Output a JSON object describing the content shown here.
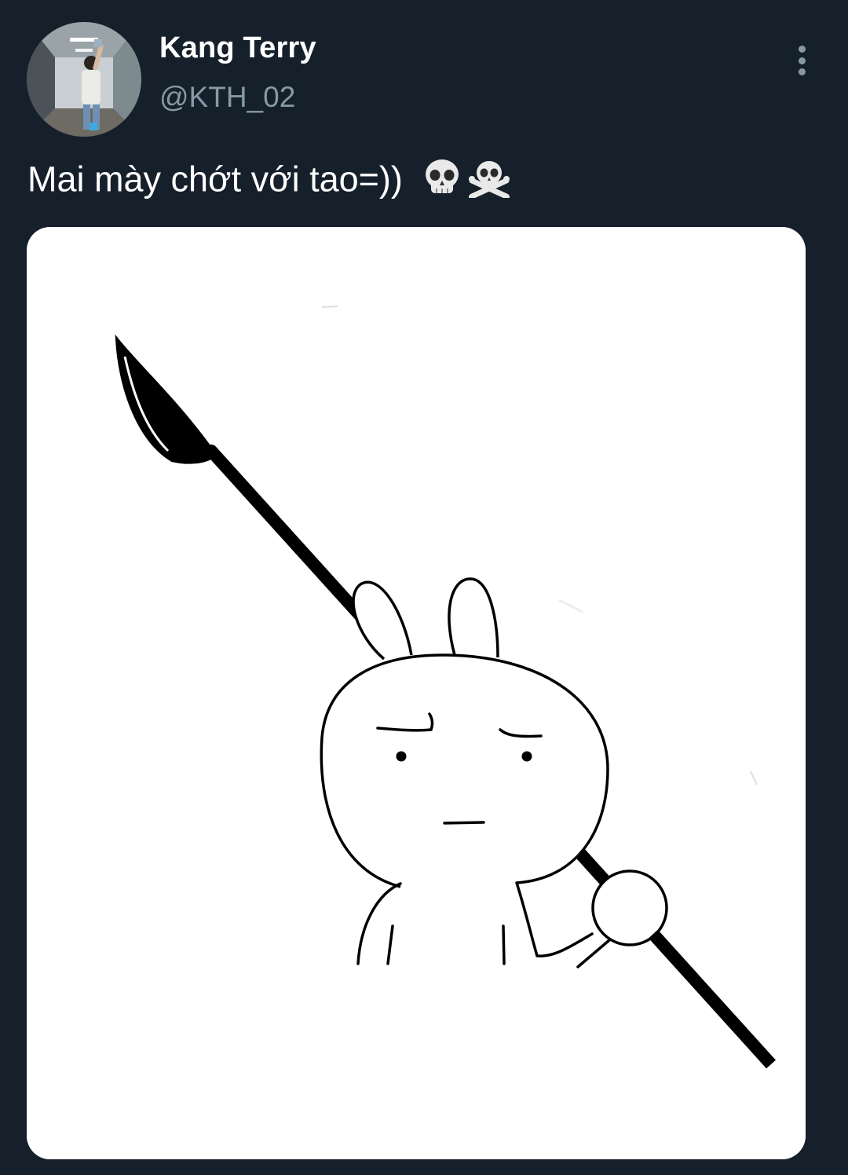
{
  "tweet": {
    "author": {
      "display_name": "Kang Terry",
      "handle": "@KTH_02",
      "avatar_icon": "profile-photo"
    },
    "text": "Mai mày chớt với tao=))",
    "emojis": [
      "skull",
      "skull-and-crossbones"
    ],
    "menu_icon": "more-vertical-icon",
    "media_icon": "rabbit-with-spear-illustration"
  },
  "colors": {
    "background": "#15202b",
    "primary_text": "#ffffff",
    "secondary_text": "#8899a6"
  }
}
